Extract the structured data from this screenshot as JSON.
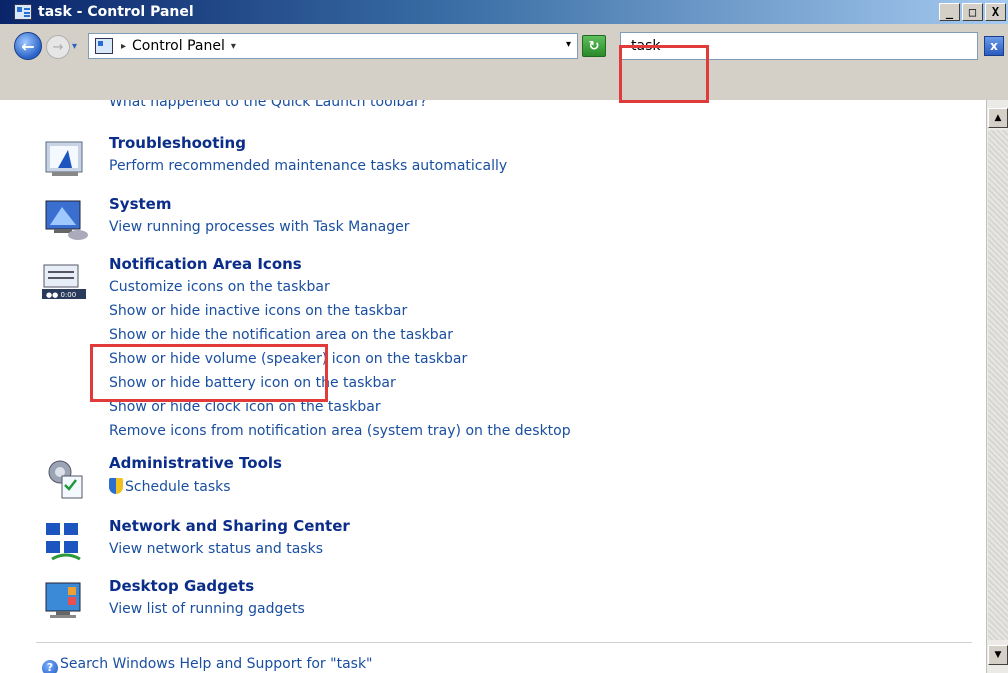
{
  "window": {
    "title": "task - Control Panel"
  },
  "window_buttons": {
    "minimize": "_",
    "maximize": "□",
    "close": "X"
  },
  "nav": {
    "back_glyph": "←",
    "forward_glyph": "→",
    "recent_glyph": "▾",
    "breadcrumb": "Control Panel",
    "breadcrumb_sep": "▸",
    "breadcrumb_drop": "▾",
    "address_drop": "▾",
    "refresh_glyph": "↻"
  },
  "search": {
    "value": "task",
    "clear_glyph": "x"
  },
  "content": {
    "cut_link": "What happened to the Quick Launch toolbar?",
    "sections": [
      {
        "title": "Troubleshooting",
        "links": [
          "Perform recommended maintenance tasks automatically"
        ]
      },
      {
        "title": "System",
        "links": [
          "View running processes with Task Manager"
        ]
      },
      {
        "title": "Notification Area Icons",
        "links": [
          "Customize icons on the taskbar",
          "Show or hide inactive icons on the taskbar",
          "Show or hide the notification area on the taskbar",
          "Show or hide volume (speaker) icon on the taskbar",
          "Show or hide battery icon on the taskbar",
          "Show or hide clock icon on the taskbar",
          "Remove icons from notification area (system tray) on the desktop"
        ],
        "icon_text": "●● 0:00"
      },
      {
        "title": "Administrative Tools",
        "links": [
          "Schedule tasks"
        ]
      },
      {
        "title": "Network and Sharing Center",
        "links": [
          "View network status and tasks"
        ]
      },
      {
        "title": "Desktop Gadgets",
        "links": [
          "View list of running gadgets"
        ]
      }
    ],
    "help_text": "Search Windows Help and Support for \"task\"",
    "help_icon": "?"
  },
  "scrollbar": {
    "up": "▲",
    "down": "▼"
  },
  "colors": {
    "highlight": "#e03a3a",
    "link": "#1a4fa0",
    "title": "#0b2d8a"
  }
}
